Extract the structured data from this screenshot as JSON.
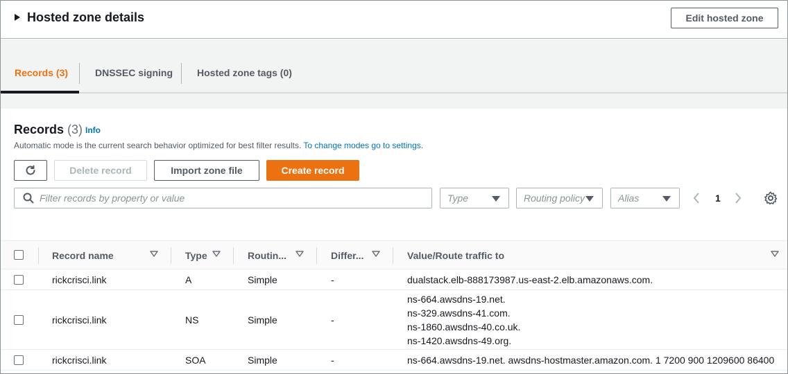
{
  "hosted_zone": {
    "title": "Hosted zone details",
    "edit_button": "Edit hosted zone"
  },
  "tabs": [
    {
      "label": "Records (3)",
      "active": true
    },
    {
      "label": "DNSSEC signing",
      "active": false
    },
    {
      "label": "Hosted zone tags (0)",
      "active": false
    }
  ],
  "records": {
    "title": "Records",
    "count": "(3)",
    "info_link": "Info",
    "description": "Automatic mode is the current search behavior optimized for best filter results.",
    "description_link": "To change modes go to settings.",
    "buttons": {
      "refresh_icon": "refresh-icon",
      "delete": "Delete record",
      "import": "Import zone file",
      "create": "Create record"
    },
    "filter": {
      "search_placeholder": "Filter records by property or value",
      "type_placeholder": "Type",
      "routing_placeholder": "Routing policy",
      "alias_placeholder": "Alias"
    },
    "pagination": {
      "current_page": "1"
    },
    "columns": [
      "Record name",
      "Type",
      "Routin...",
      "Differ...",
      "Value/Route traffic to"
    ],
    "rows": [
      {
        "name": "rickcrisci.link",
        "type": "A",
        "routing": "Simple",
        "differ": "-",
        "values": [
          "dualstack.elb-888173987.us-east-2.elb.amazonaws.com."
        ]
      },
      {
        "name": "rickcrisci.link",
        "type": "NS",
        "routing": "Simple",
        "differ": "-",
        "values": [
          "ns-664.awsdns-19.net.",
          "ns-329.awsdns-41.com.",
          "ns-1860.awsdns-40.co.uk.",
          "ns-1420.awsdns-49.org."
        ]
      },
      {
        "name": "rickcrisci.link",
        "type": "SOA",
        "routing": "Simple",
        "differ": "-",
        "values": [
          "ns-664.awsdns-19.net. awsdns-hostmaster.amazon.com. 1 7200 900 1209600 86400"
        ]
      }
    ]
  },
  "colors": {
    "accent": "#ec7211",
    "link": "#0073bb",
    "text": "#16191f",
    "muted": "#545b64"
  }
}
